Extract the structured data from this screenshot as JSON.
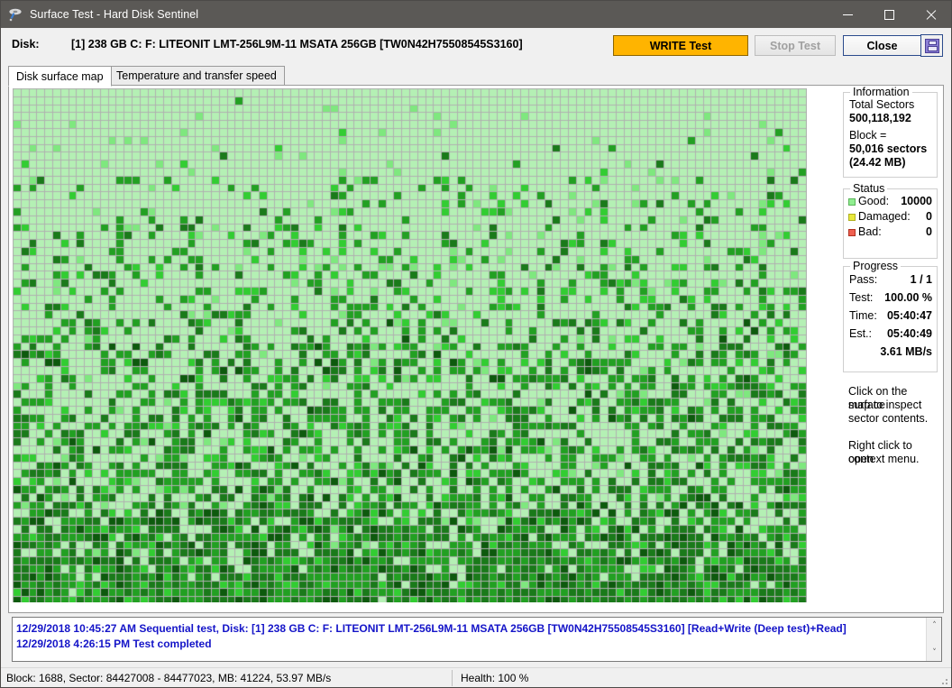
{
  "window": {
    "title": "Surface Test - Hard Disk Sentinel",
    "icon": "disk-probe-icon",
    "minimize": "—",
    "maximize": "□",
    "close": "✕"
  },
  "toolbar": {
    "disk_label": "Disk:",
    "disk_value": "[1] 238 GB C: F: LITEONIT LMT-256L9M-11 MSATA 256GB [TW0N42H75508545S3160]",
    "write_test_label": "WRITE Test",
    "stop_test_label": "Stop Test",
    "close_label": "Close",
    "save_icon": "floppy-save-icon",
    "accent_orange": "#ffb400",
    "accent_blue": "#2b4b8c"
  },
  "tabs": [
    {
      "label": "Disk surface map",
      "active": true
    },
    {
      "label": "Temperature and transfer speed",
      "active": false
    }
  ],
  "information": {
    "legend": "Information",
    "total_sectors_label": "Total Sectors",
    "total_sectors_value": "500,118,192",
    "block_label": "Block =",
    "block_value": "50,016 sectors",
    "block_size": "(24.42 MB)"
  },
  "status": {
    "legend": "Status",
    "rows": [
      {
        "label": "Good:",
        "value": "10000",
        "color": "#90ee90"
      },
      {
        "label": "Damaged:",
        "value": "0",
        "color": "#e8e83c"
      },
      {
        "label": "Bad:",
        "value": "0",
        "color": "#f06050"
      }
    ]
  },
  "progress": {
    "legend": "Progress",
    "rows": [
      {
        "label": "Pass:",
        "value": "1 / 1"
      },
      {
        "label": "Test:",
        "value": "100.00 %"
      },
      {
        "label": "Time:",
        "value": "05:40:47"
      },
      {
        "label": "Est.:",
        "value": "05:40:49"
      },
      {
        "label": "",
        "value": "3.61 MB/s"
      }
    ]
  },
  "hints": {
    "line1": "Click on the surface",
    "line2": "map to inspect",
    "line3": "sector contents.",
    "line4": "Right click to open",
    "line5": "context menu."
  },
  "log": {
    "lines": [
      "12/29/2018  10:45:27 AM   Sequential test, Disk: [1] 238 GB C: F: LITEONIT LMT-256L9M-11 MSATA 256GB [TW0N42H75508545S3160] [Read+Write (Deep test)+Read]",
      "12/29/2018  4:26:15 PM   Test completed"
    ],
    "scroll_up": "˄",
    "scroll_down": "˅",
    "text_color": "#1414c8"
  },
  "statusbar": {
    "left": "Block: 1688, Sector: 84427008 - 84477023, MB: 41224, 53.97 MB/s",
    "right": "Health: 100 %"
  },
  "surface_map": {
    "cols": 100,
    "rows": 65,
    "cell": 8.8,
    "grid_color": "#b0b0b0",
    "palette": [
      "#b4f0b4",
      "#7ee87e",
      "#32cd32",
      "#22a022",
      "#1a7a1a",
      "#0d5a0d"
    ],
    "description": "Disk surface block map, 10000 good blocks, density of darker (more-accessed) blocks increases toward the bottom"
  }
}
